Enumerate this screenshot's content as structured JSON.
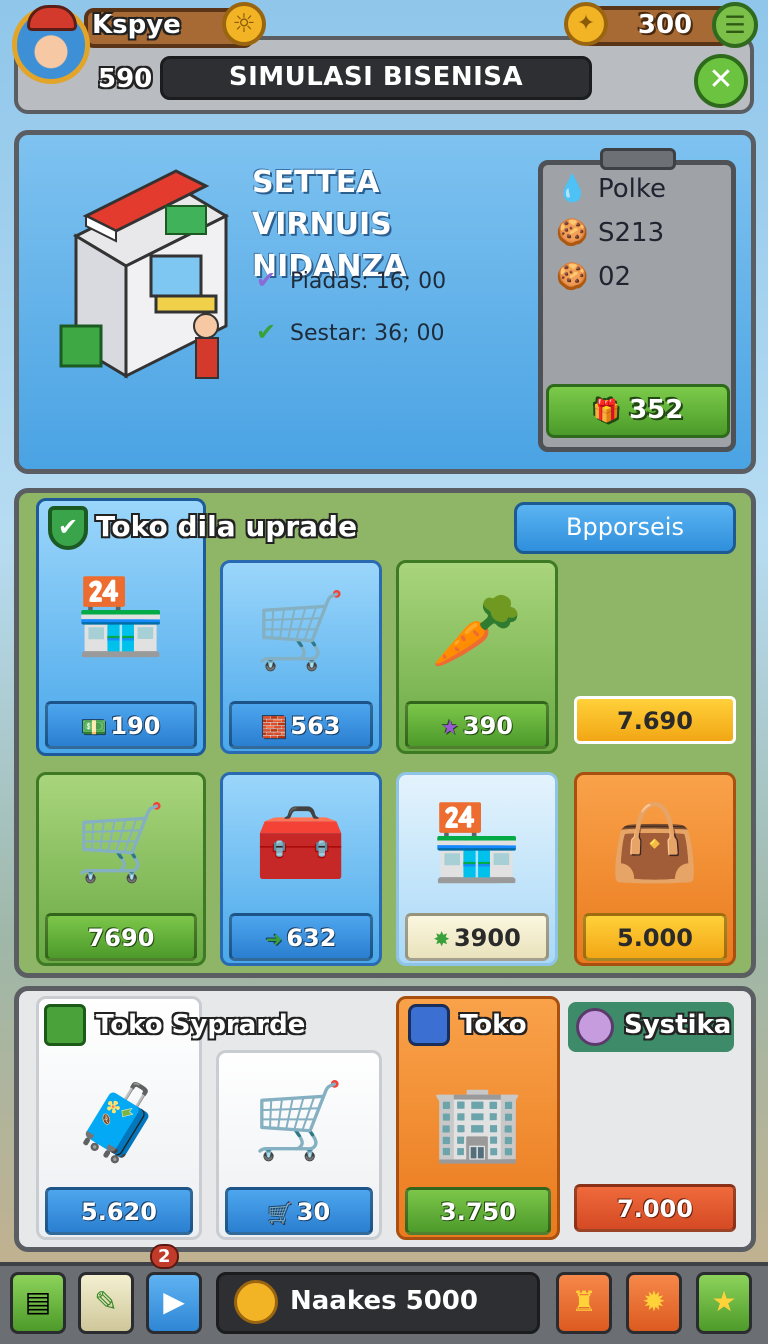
{
  "header": {
    "player_name": "Kspye",
    "level": "590",
    "title": "SIMULASI BISENISA",
    "coins": "300"
  },
  "info": {
    "shop_name": "SETTEA VIRNUIS NIDANZA",
    "stat1": "Piadas: 16; 00",
    "stat2": "Sestar: 36; 00",
    "side_label": "Polke",
    "side_value1": "S213",
    "side_value2": "02",
    "side_button": "352"
  },
  "upgrade": {
    "title": "Toko dila uprade",
    "button": "Bpporseis",
    "cards": [
      {
        "price": "190",
        "art": "🏪",
        "icon": "cash-icon"
      },
      {
        "price": "563",
        "art": "🛒",
        "icon": "bricks-icon"
      },
      {
        "price": "390",
        "art": "🥕",
        "icon": "star-icon"
      },
      {
        "price": "7.690",
        "art": "",
        "icon": ""
      },
      {
        "price": "7690",
        "art": "🛒",
        "icon": ""
      },
      {
        "price": "632",
        "art": "🧰",
        "icon": "arrow-icon"
      },
      {
        "price": "3900",
        "art": "🏪",
        "icon": "gem-icon"
      },
      {
        "price": "5.000",
        "art": "👜",
        "icon": ""
      }
    ]
  },
  "shop": {
    "tab1": "Toko Syprarde",
    "tab2": "Toko",
    "tab3": "Systika",
    "items": [
      {
        "price": "5.620",
        "art": "🧳"
      },
      {
        "price": "30",
        "art": "🛒"
      },
      {
        "price": "3.750",
        "art": "🏢"
      },
      {
        "price": "7.000",
        "art": ""
      }
    ]
  },
  "nav": {
    "badge": "2",
    "center_label": "Naakes 5000"
  },
  "colors": {
    "panel_blue": "#4aa3e3",
    "panel_green": "#8fb567",
    "accent_gold": "#f2b424",
    "accent_orange": "#ea7a1e"
  }
}
